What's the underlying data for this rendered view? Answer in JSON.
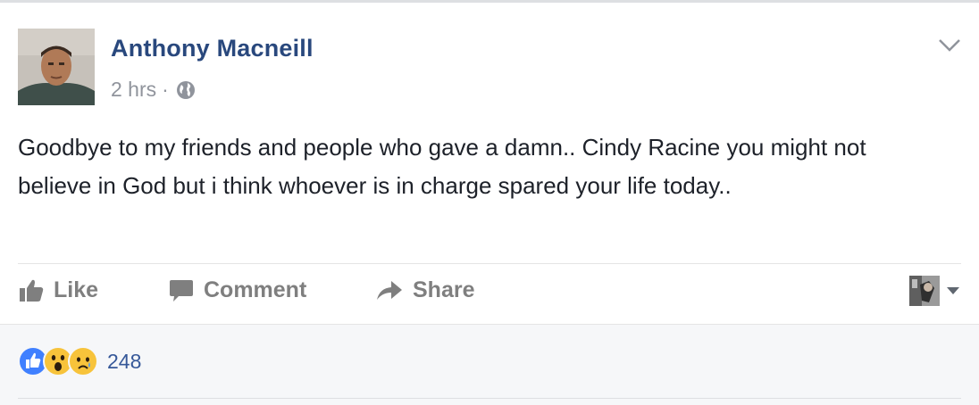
{
  "post": {
    "author": "Anthony Macneill",
    "time": "2 hrs",
    "separator": "·",
    "privacy_icon": "globe-icon",
    "text": "Goodbye to my friends and people who gave a damn.. Cindy Racine you might not believe in God but i think whoever is in charge spared your life today.."
  },
  "actions": {
    "like_label": "Like",
    "comment_label": "Comment",
    "share_label": "Share"
  },
  "reactions": {
    "icons": [
      "like-reaction-icon",
      "wow-reaction-icon",
      "sad-reaction-icon"
    ],
    "count": "248"
  },
  "colors": {
    "author": "#29487d",
    "meta": "#90949c",
    "action": "#7f7f7f",
    "link": "#365899",
    "like_blue": "#4080ff",
    "emoji_yellow": "#f7c33b"
  }
}
